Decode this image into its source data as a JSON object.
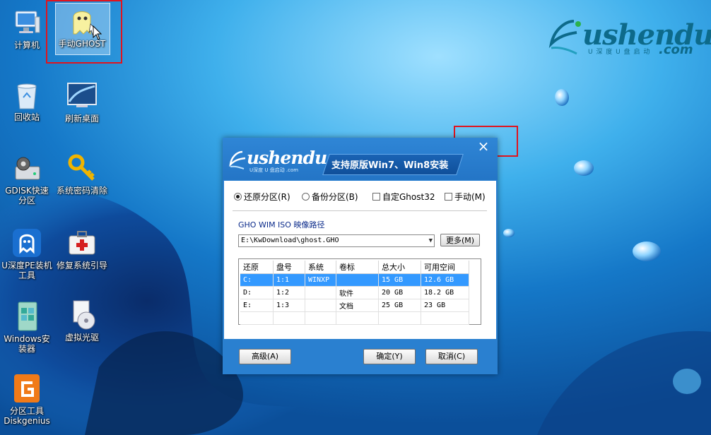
{
  "desktop": {
    "icons": [
      {
        "label": "计算机"
      },
      {
        "label": "手动GHOST"
      },
      {
        "label": "回收站"
      },
      {
        "label": "刷新桌面"
      },
      {
        "label": "GDISK快速分区"
      },
      {
        "label": "系统密码清除"
      },
      {
        "label": "U深度PE装机工具"
      },
      {
        "label": "修复系统引导"
      },
      {
        "label": "Windows安装器"
      },
      {
        "label": "虚拟光驱"
      },
      {
        "label": "分区工具Diskgenius"
      }
    ]
  },
  "brand": {
    "word": "ushendu",
    "com": ".com",
    "subtitle": "U 深 度 U 盘 启 动"
  },
  "dialog": {
    "logo_word": "ushendu",
    "logo_sub": "U深度 U 盘启动 .com",
    "banner": "支持原版Win7、Win8安装",
    "close": "×",
    "options": [
      {
        "label": "还原分区(R)",
        "type": "radio",
        "checked": true
      },
      {
        "label": "备份分区(B)",
        "type": "radio",
        "checked": false
      },
      {
        "label": "自定Ghost32",
        "type": "checkbox",
        "checked": false
      },
      {
        "label": "手动(M)",
        "type": "checkbox",
        "checked": false
      }
    ],
    "path_label": "GHO WIM ISO 映像路径",
    "path_value": "E:\\KwDownload\\ghost.GHO",
    "more_button": "更多(M)",
    "table": {
      "headers": [
        "还原",
        "盘号",
        "系统",
        "卷标",
        "总大小",
        "可用空间"
      ],
      "rows": [
        [
          "C:",
          "1:1",
          "WINXP",
          "",
          "15 GB",
          "12.6 GB"
        ],
        [
          "D:",
          "1:2",
          "",
          "软件",
          "20 GB",
          "18.2 GB"
        ],
        [
          "E:",
          "1:3",
          "",
          "文档",
          "25 GB",
          "23 GB"
        ]
      ]
    },
    "buttons": {
      "advanced": "高级(A)",
      "ok": "确定(Y)",
      "cancel": "取消(C)"
    }
  }
}
